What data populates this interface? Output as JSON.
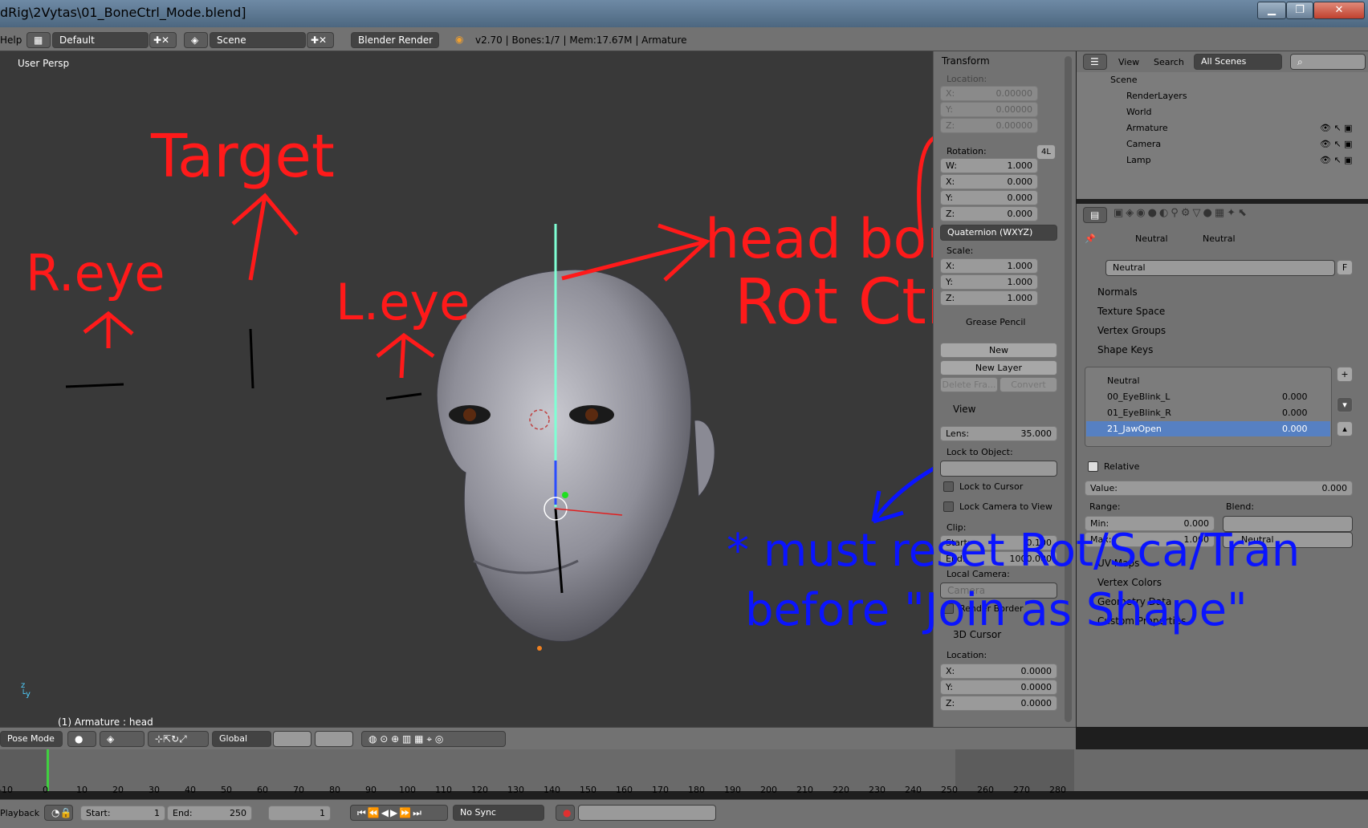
{
  "titlebar": {
    "title": "dRig\\2Vytas\\01_BoneCtrl_Mode.blend]",
    "min": "▁",
    "max": "❐",
    "close": "✕"
  },
  "topbar": {
    "help": "Help",
    "layout": "Default",
    "scene": "Scene",
    "engine": "Blender Render",
    "stats": "v2.70 | Bones:1/7 | Mem:17.67M | Armature"
  },
  "viewport": {
    "label": "User Persp",
    "status": "(1) Armature : head",
    "mode": "Pose Mode",
    "orientation": "Global"
  },
  "npanel": {
    "transform": "Transform",
    "location": "Location:",
    "loc": [
      {
        "a": "X:",
        "v": "0.00000"
      },
      {
        "a": "Y:",
        "v": "0.00000"
      },
      {
        "a": "Z:",
        "v": "0.00000"
      }
    ],
    "rotation": "Rotation:",
    "rot_badge": "4L",
    "rot": [
      {
        "a": "W:",
        "v": "1.000"
      },
      {
        "a": "X:",
        "v": "0.000"
      },
      {
        "a": "Y:",
        "v": "0.000"
      },
      {
        "a": "Z:",
        "v": "0.000"
      }
    ],
    "rot_mode": "Quaternion (WXYZ)",
    "scale": "Scale:",
    "scl": [
      {
        "a": "X:",
        "v": "1.000"
      },
      {
        "a": "Y:",
        "v": "1.000"
      },
      {
        "a": "Z:",
        "v": "1.000"
      }
    ],
    "grease": "Grease Pencil",
    "new": "New",
    "new_layer": "New Layer",
    "delete_frame": "Delete Fra...",
    "convert": "Convert",
    "view": "View",
    "lens_l": "Lens:",
    "lens_v": "35.000",
    "lock_obj": "Lock to Object:",
    "lock_cursor": "Lock to Cursor",
    "lock_camera": "Lock Camera to View",
    "clip": "Clip:",
    "start_l": "Start:",
    "start_v": "0.100",
    "end_l": "End:",
    "end_v": "1000.000",
    "local_camera": "Local Camera:",
    "camera": "Camera",
    "render_border": "Render Border",
    "cursor3d": "3D Cursor",
    "cur_loc": "Location:",
    "cur": [
      {
        "a": "X:",
        "v": "0.0000"
      },
      {
        "a": "Y:",
        "v": "0.0000"
      },
      {
        "a": "Z:",
        "v": "0.0000"
      }
    ]
  },
  "outliner": {
    "view": "View",
    "search": "Search",
    "filter": "All Scenes",
    "items": [
      {
        "label": "Scene"
      },
      {
        "label": "RenderLayers"
      },
      {
        "label": "World"
      },
      {
        "label": "Armature"
      },
      {
        "label": "Camera"
      },
      {
        "label": "Lamp"
      }
    ]
  },
  "props": {
    "breadcrumb1": "Neutral",
    "breadcrumb2": "Neutral",
    "mesh_name": "Neutral",
    "fake_user": "F",
    "normals": "Normals",
    "texture_space": "Texture Space",
    "vertex_groups": "Vertex Groups",
    "shape_keys": "Shape Keys",
    "keys": [
      {
        "name": "Neutral",
        "value": ""
      },
      {
        "name": "00_EyeBlink_L",
        "value": "0.000"
      },
      {
        "name": "01_EyeBlink_R",
        "value": "0.000"
      },
      {
        "name": "21_JawOpen",
        "value": "0.000"
      }
    ],
    "relative": "Relative",
    "value_l": "Value:",
    "value_v": "0.000",
    "range": "Range:",
    "blend": "Blend:",
    "min_l": "Min:",
    "min_v": "0.000",
    "max_l": "Max:",
    "max_v": "1.000",
    "blend_v": "Neutral",
    "uv_maps": "UV Maps",
    "vertex_colors": "Vertex Colors",
    "geometry_data": "Geometry Data",
    "custom_props": "Custom Properties"
  },
  "timeline": {
    "ticks": [
      "-10",
      "0",
      "10",
      "20",
      "30",
      "40",
      "50",
      "60",
      "70",
      "80",
      "90",
      "100",
      "110",
      "120",
      "130",
      "140",
      "150",
      "160",
      "170",
      "180",
      "190",
      "200",
      "210",
      "220",
      "230",
      "240",
      "250",
      "260",
      "270",
      "280"
    ],
    "playback": "Playback",
    "start_l": "Start:",
    "start_v": "1",
    "end_l": "End:",
    "end_v": "250",
    "frame": "1",
    "sync": "No Sync"
  },
  "annotations": {
    "target": "Target",
    "reye": "R.eye",
    "leye": "L.eye",
    "headbone": "head bone",
    "rotctrl": "Rot Ctrl.",
    "note1": "* must reset Rot/Sca/Tran",
    "note2": "before \"Join as Shape\""
  }
}
